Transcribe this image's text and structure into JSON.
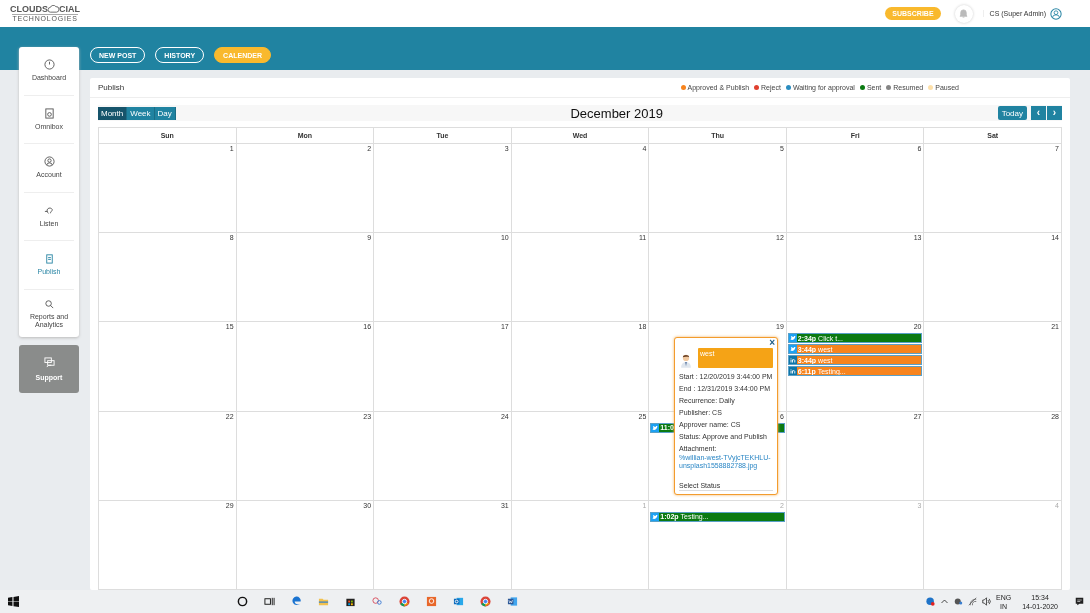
{
  "header": {
    "subscribe": "SUBSCRIBE",
    "user": "CS (Super Admin)"
  },
  "logo": {
    "line_1": "CLOUDS",
    "line_1b": "CIAL",
    "line_2": "TECHNOLOGIES"
  },
  "sidebar": {
    "items": [
      {
        "label": "Dashboard",
        "selected": false
      },
      {
        "label": "Omnibox",
        "selected": false
      },
      {
        "label": "Account",
        "selected": false
      },
      {
        "label": "Listen",
        "selected": false
      },
      {
        "label": "Publish",
        "selected": true
      },
      {
        "label": "Reports and Analytics",
        "selected": false
      }
    ],
    "support": "Support"
  },
  "nav_tabs": [
    {
      "label": "NEW POST",
      "selected": false
    },
    {
      "label": "HISTORY",
      "selected": false
    },
    {
      "label": "CALENDER",
      "selected": true
    }
  ],
  "panel": {
    "title": "Publish",
    "legend": [
      {
        "label": "Approved & Publish",
        "color": "#f7841e"
      },
      {
        "label": "Reject",
        "color": "#e0402f"
      },
      {
        "label": "Waiting for approval",
        "color": "#2b8dc0"
      },
      {
        "label": "Sent",
        "color": "#0b7a12"
      },
      {
        "label": "Resumed",
        "color": "#858585"
      },
      {
        "label": "Paused",
        "color": "#fde0aa"
      }
    ]
  },
  "calendar": {
    "views": [
      {
        "label": "Month",
        "selected": true
      },
      {
        "label": "Week",
        "selected": false
      },
      {
        "label": "Day",
        "selected": false
      }
    ],
    "title": "December 2019",
    "today": "Today",
    "prev": "‹",
    "next": "›",
    "weekdays": [
      "Sun",
      "Mon",
      "Tue",
      "Wed",
      "Thu",
      "Fri",
      "Sat"
    ],
    "weeks": [
      {
        "days": [
          {
            "number": "1",
            "other_month": false
          },
          {
            "number": "2",
            "other_month": false
          },
          {
            "number": "3",
            "other_month": false
          },
          {
            "number": "4",
            "other_month": false
          },
          {
            "number": "5",
            "other_month": false
          },
          {
            "number": "6",
            "other_month": false
          },
          {
            "number": "7",
            "other_month": false
          }
        ]
      },
      {
        "days": [
          {
            "number": "8",
            "other_month": false
          },
          {
            "number": "9",
            "other_month": false
          },
          {
            "number": "10",
            "other_month": false
          },
          {
            "number": "11",
            "other_month": false
          },
          {
            "number": "12",
            "other_month": false
          },
          {
            "number": "13",
            "other_month": false
          },
          {
            "number": "14",
            "other_month": false
          }
        ]
      },
      {
        "days": [
          {
            "number": "15",
            "other_month": false
          },
          {
            "number": "16",
            "other_month": false
          },
          {
            "number": "17",
            "other_month": false
          },
          {
            "number": "18",
            "other_month": false
          },
          {
            "number": "19",
            "other_month": false
          },
          {
            "number": "20",
            "other_month": false,
            "events": [
              {
                "kind": "twitter",
                "time": "2:34p",
                "title": "Click t...",
                "color": "#0b7a12"
              },
              {
                "kind": "twitter",
                "time": "3:44p",
                "title": "west",
                "color": "#f7841e"
              },
              {
                "kind": "linkedin",
                "time": "3:44p",
                "title": "west",
                "color": "#f7841e"
              },
              {
                "kind": "linkedin",
                "time": "6:11p",
                "title": "Testing...",
                "color": "#f7841e"
              }
            ]
          },
          {
            "number": "21",
            "other_month": false
          }
        ]
      },
      {
        "days": [
          {
            "number": "22",
            "other_month": false
          },
          {
            "number": "23",
            "other_month": false
          },
          {
            "number": "24",
            "other_month": false
          },
          {
            "number": "25",
            "other_month": false
          },
          {
            "number": "6",
            "other_month": false,
            "events": [
              {
                "kind": "twitter",
                "time": "11:0",
                "color": "#0b7a12"
              }
            ]
          },
          {
            "number": "27",
            "other_month": false
          },
          {
            "number": "28",
            "other_month": false
          }
        ]
      },
      {
        "days": [
          {
            "number": "29",
            "other_month": false
          },
          {
            "number": "30",
            "other_month": false
          },
          {
            "number": "31",
            "other_month": false
          },
          {
            "number": "1",
            "other_month": true
          },
          {
            "number": "2",
            "other_month": true,
            "events": [
              {
                "kind": "twitter",
                "time": "1:02p",
                "title": "Testing...",
                "color": "#0b7a12"
              }
            ]
          },
          {
            "number": "3",
            "other_month": true
          },
          {
            "number": "4",
            "other_month": true
          }
        ]
      }
    ]
  },
  "popover": {
    "close": "×",
    "title": "west",
    "lines": [
      "Start : 12/20/2019 3:44:00 PM",
      "End : 12/31/2019 3:44:00 PM",
      "Recurrence: Daily",
      "Publisher: CS",
      "Approver name: CS",
      "Status: Approve and Publish"
    ],
    "attachment_label": "Attachment:",
    "attachment_link": "%willian-west-TVyjcTEKHLU-unsplash1558882788.jpg",
    "select_status": "Select Status"
  },
  "taskbar": {
    "apps": [
      {
        "kind": "search"
      },
      {
        "kind": "taskview"
      },
      {
        "kind": "edge"
      },
      {
        "kind": "explorer"
      },
      {
        "kind": "store"
      },
      {
        "kind": "snip"
      },
      {
        "kind": "chrome"
      },
      {
        "kind": "orange"
      },
      {
        "kind": "outlook"
      },
      {
        "kind": "chrome"
      },
      {
        "kind": "word"
      }
    ],
    "language": "ENG",
    "region": "IN",
    "time": "15:34",
    "date": "14-01-2020"
  }
}
